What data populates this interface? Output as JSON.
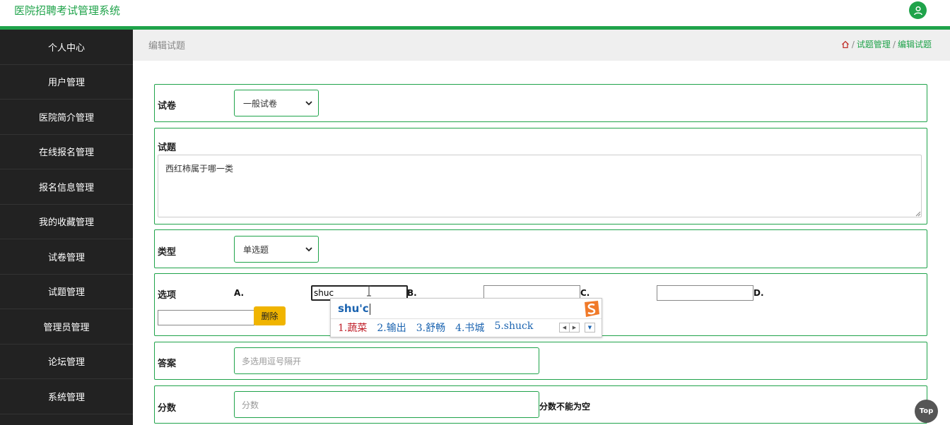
{
  "header": {
    "app_title": "医院招聘考试管理系统"
  },
  "sidebar": {
    "items": [
      {
        "label": "个人中心"
      },
      {
        "label": "用户管理"
      },
      {
        "label": "医院简介管理"
      },
      {
        "label": "在线报名管理"
      },
      {
        "label": "报名信息管理"
      },
      {
        "label": "我的收藏管理"
      },
      {
        "label": "试卷管理"
      },
      {
        "label": "试题管理"
      },
      {
        "label": "管理员管理"
      },
      {
        "label": "论坛管理"
      },
      {
        "label": "系统管理"
      }
    ]
  },
  "breadcrumb": {
    "page_title": "编辑试题",
    "items": [
      "试题管理",
      "编辑试题"
    ],
    "separator": "/"
  },
  "form": {
    "paper": {
      "label": "试卷",
      "selected": "一般试卷"
    },
    "question": {
      "label": "试题",
      "value": "西红柿属于哪一类"
    },
    "type": {
      "label": "类型",
      "selected": "单选题"
    },
    "options": {
      "label": "选项",
      "a_label": "A.",
      "a_value": "shuc",
      "b_label": "B.",
      "b_value": "",
      "c_label": "C.",
      "c_value": "",
      "d_label": "D.",
      "d_value": "",
      "delete_label": "删除"
    },
    "answer": {
      "label": "答案",
      "placeholder": "多选用逗号隔开"
    },
    "score": {
      "label": "分数",
      "placeholder": "分数",
      "error": "分数不能为空"
    }
  },
  "ime": {
    "pinyin": "shu'c",
    "candidates": [
      "1.蔬菜",
      "2.输出",
      "3.舒畅",
      "4.书城",
      "5.shuck"
    ]
  },
  "top_button": {
    "label": "Top"
  },
  "colors": {
    "accent": "#1fa34a",
    "sidebar_bg": "#222222",
    "delete_btn": "#f0b400"
  }
}
